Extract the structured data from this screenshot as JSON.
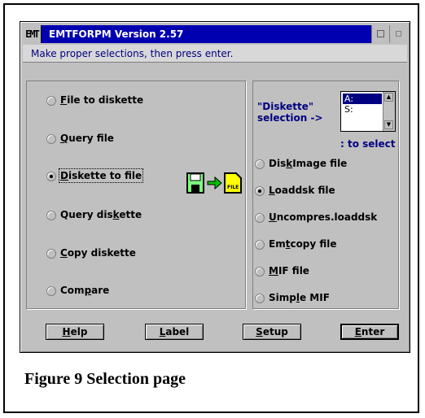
{
  "window": {
    "title": "EMTFORPM Version 2.57",
    "sys_icon_text": "EMT",
    "instruction": "Make proper selections, then press enter."
  },
  "left_options": [
    {
      "pre": "",
      "ul": "F",
      "post": "ile to diskette",
      "selected": false
    },
    {
      "pre": "",
      "ul": "Q",
      "post": "uery file",
      "selected": false
    },
    {
      "pre": "",
      "ul": "D",
      "post": "iskette to file",
      "selected": true
    },
    {
      "pre": "Query dis",
      "ul": "k",
      "post": "ette",
      "selected": false
    },
    {
      "pre": "",
      "ul": "C",
      "post": "opy diskette",
      "selected": false
    },
    {
      "pre": "Com",
      "ul": "p",
      "post": "are",
      "selected": false
    }
  ],
  "illustration": {
    "file_label": "FILE"
  },
  "diskette_select": {
    "label_line1": "\"Diskette\"",
    "label_line2": "selection ->",
    "items": [
      "A:",
      "S:"
    ],
    "selected_index": 0,
    "hint": ": to select"
  },
  "right_options": [
    {
      "pre": "Dis",
      "ul": "k",
      "post": "Image file",
      "selected": false
    },
    {
      "pre": "",
      "ul": "L",
      "post": "oaddsk file",
      "selected": true
    },
    {
      "pre": "",
      "ul": "U",
      "post": "ncompres.loaddsk",
      "selected": false
    },
    {
      "pre": "Em",
      "ul": "t",
      "post": "copy file",
      "selected": false
    },
    {
      "pre": "",
      "ul": "M",
      "post": "IF file",
      "selected": false
    },
    {
      "pre": "Simp",
      "ul": "l",
      "post": "e MIF",
      "selected": false
    }
  ],
  "buttons": [
    {
      "pre": "",
      "ul": "H",
      "post": "elp"
    },
    {
      "pre": "",
      "ul": "L",
      "post": "abel"
    },
    {
      "pre": "",
      "ul": "S",
      "post": "etup"
    },
    {
      "pre": "",
      "ul": "E",
      "post": "nter"
    }
  ],
  "caption": "Figure 9 Selection page"
}
